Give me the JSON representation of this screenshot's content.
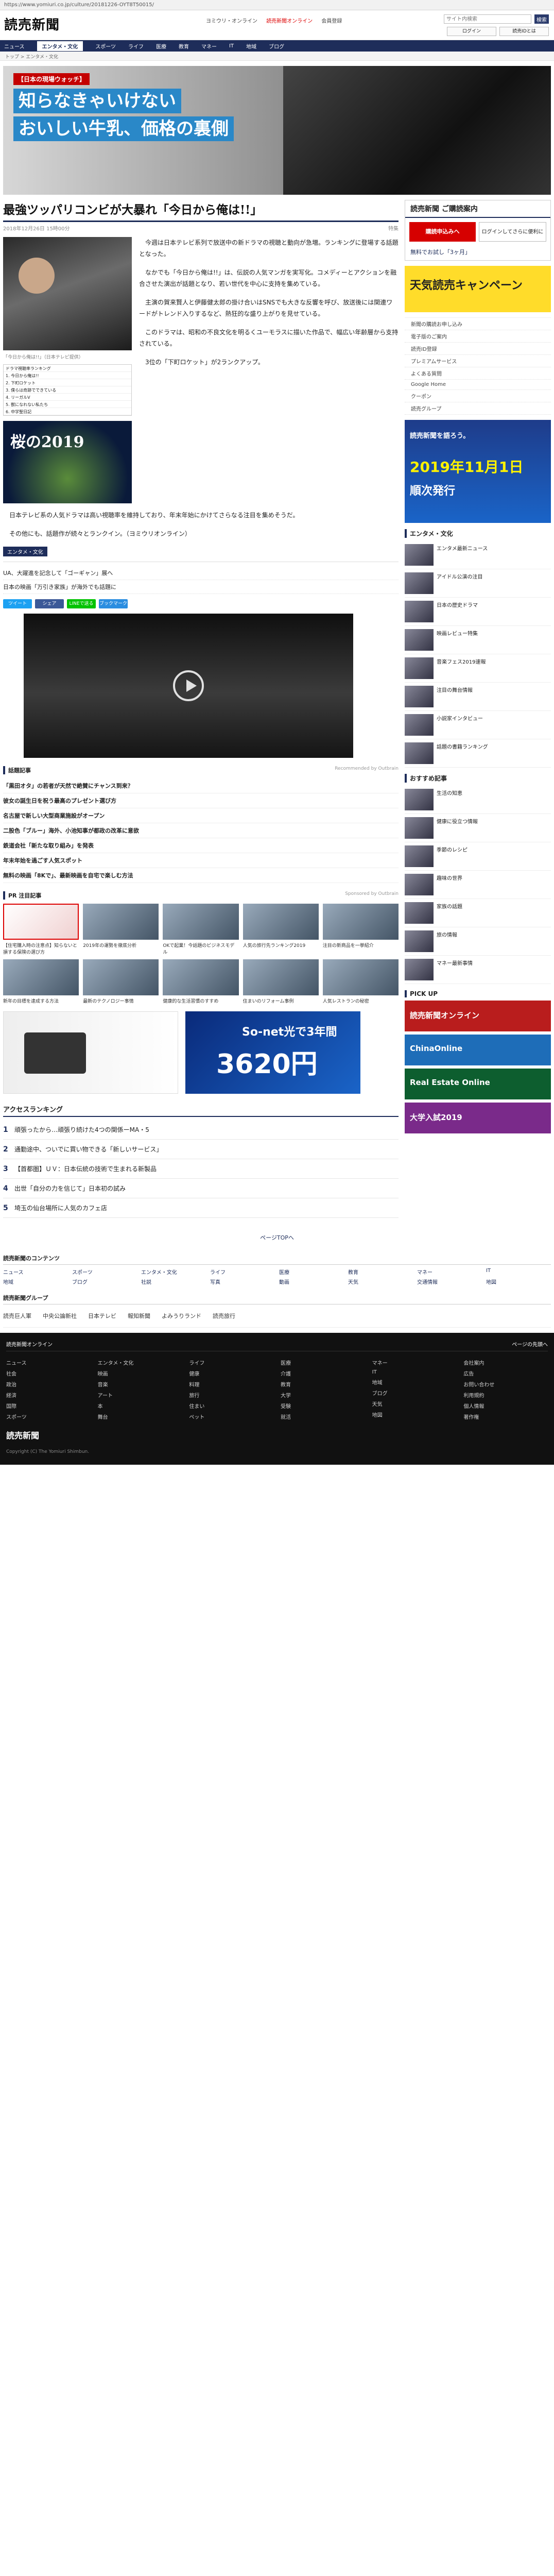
{
  "browser": {
    "url": "https://www.yomiuri.co.jp/culture/20181226-OYT8T50015/"
  },
  "site": {
    "logo_text": "読売新聞",
    "top_links": [
      "ヨミウリ・オンライン",
      "読売新聞オンライン",
      "会員登録"
    ],
    "search_placeholder": "サイト内検索",
    "search_button": "検索",
    "badges": [
      "ログイン",
      "読売IDとは"
    ]
  },
  "nav": {
    "items": [
      "ニュース",
      "エンタメ・文化",
      "スポーツ",
      "ライフ",
      "医療",
      "教育",
      "マネー",
      "IT",
      "地域",
      "ブログ"
    ],
    "active_index": 1,
    "breadcrumb": "トップ > エンタメ・文化"
  },
  "hero": {
    "tag": "【日本の現場ウォッチ】",
    "lines": [
      "【日本の現場ウォッチ】",
      "知らなきゃいけない",
      "おいしい牛乳、価格の裏側"
    ]
  },
  "article": {
    "title": "最強ツッパリコンビが大暴れ「今日から俺は!!」",
    "meta_left": "2018年12月26日 15時00分",
    "meta_right": "特集",
    "photo_caption": "「今日から俺は!!」（日本テレビ提供）",
    "table_rows": [
      "ドラマ視聴率ランキング",
      "1. 今日から俺は!!",
      "2. 下町ロケット",
      "3. 僕らは奇跡でできている",
      "4. リーガルV",
      "5. 獣になれない私たち",
      "6. 中学聖日記"
    ],
    "ad_card_text": "桜の2019",
    "paragraphs": [
      "今週は日本テレビ系列で放送中の新ドラマの視聴と動向が急増。ランキングに登場する話題となった。",
      "なかでも「今日から俺は!!」は、伝説の人気マンガを実写化。コメディーとアクションを融合させた演出が話題となり、若い世代を中心に支持を集めている。",
      "主演の賀来賢人と伊藤健太郎の掛け合いはSNSでも大きな反響を呼び、放送後には関連ワードがトレンド入りするなど、熱狂的な盛り上がりを見せている。",
      "このドラマは、昭和の不良文化を明るくユーモラスに描いた作品で、幅広い年齢層から支持されている。",
      "3位の「下町ロケット」が2ランクアップ。"
    ],
    "tail_paragraphs": [
      "日本テレビ系の人気ドラマは高い視聴率を維持しており、年末年始にかけてさらなる注目を集めそうだ。",
      "その他にも、話題作が続々とランクイン。（ヨミウリオンライン）"
    ],
    "category_tag": "エンタメ・文化",
    "related": [
      "UA、大躍進を記念して「ゴーギャン」展へ",
      "日本の映画「万引き家族」が海外でも話題に"
    ],
    "share_buttons": [
      "ツイート",
      "シェア",
      "LINEで送る",
      "ブックマーク"
    ],
    "share_colors": [
      "#1da1f2",
      "#3b5998",
      "#00c300",
      "#2a8de0"
    ]
  },
  "sections": {
    "news_label": "話題記事",
    "news_sub": "Recommended by Outbrain",
    "news_items": [
      "「黒田オタ」の若者が天然で絶賛にチャンス到来？",
      "彼女の誕生日を祝う最高のプレゼント選び方",
      "名古屋で新しい大型商業施設がオープン",
      "二股色「ブルー」海外、小池知事が都政の改革に意欲",
      "鉄道会社「新たな取り組み」を発表",
      "年末年始を過ごす人気スポット",
      "無料の映画「8Kで」、最新映画を自宅で楽しむ方法"
    ],
    "pr_label": "PR 注目記事",
    "pr_sub": "Sponsored by Outbrain",
    "cards": [
      "【住宅購入時の注意点】知らないと損する保険の選び方",
      "2019年の運勢を徹底分析",
      "OKで起業！今話題のビジネスモデル",
      "人気の旅行先ランキング2019",
      "注目の新商品を一挙紹介",
      "新年の目標を達成する方法",
      "最新のテクノロジー事情",
      "健康的な生活習慣のすすめ",
      "住まいのリフォーム事例",
      "人気レストランの秘密"
    ],
    "ad_sonet_small": "So-net光で3年間",
    "ad_sonet_big": "3620円",
    "ranking_title": "アクセスランキング",
    "ranking": [
      "頑張ったから…頑張り続けた4つの関係ーMA・5",
      "通勤途中、ついでに買い物できる「新しいサービス」",
      "【首都圏】ＵＶ：日本伝統の技術で生まれる新製品",
      "出世「自分の力を信じて」日本初の試み",
      "埼玉の仙台場所に人気のカフェ店"
    ],
    "pager": "ページTOPへ"
  },
  "sidebar": {
    "subscribe_title": "読売新聞 ご購読案内",
    "subscribe_btn": "購読申込みへ",
    "subscribe_line": "ログインしてさらに便利に",
    "subscribe_note": "無料でお試し「3ヶ月」",
    "yellow_ad": "天気読売キャンペーン",
    "side_list": [
      "新聞の購読お申し込み",
      "電子版のご案内",
      "読売ID登録",
      "プレミアムサービス",
      "よくある質問",
      "Google Home",
      "クーポン",
      "読売グループ"
    ],
    "blue_ad_headline": "読売新聞を語ろう。",
    "blue_ad_big": "2019年11月1日",
    "blue_ad_small": "順次発行",
    "entertainment_head": "エンタメ・文化",
    "side_items": [
      "エンタメ最新ニュース",
      "アイドル公演の注目",
      "日本の歴史ドラマ",
      "映画レビュー特集",
      "音楽フェス2019速報",
      "注目の舞台情報",
      "小説家インタビュー",
      "話題の書籍ランキング"
    ],
    "recommend_head": "おすすめ記事",
    "recommend_items": [
      "生活の知恵",
      "健康に役立つ情報",
      "季節のレシピ",
      "趣味の世界",
      "家族の話題",
      "旅の情報",
      "マネー最新事情"
    ],
    "pickup_head": "PICK UP",
    "banners": [
      "読売新聞オンライン",
      "ChinaOnline",
      "Real Estate Online",
      "大学入試2019"
    ],
    "banner_colors": [
      "#b91d1d",
      "#1e6db8",
      "#0d5e2f",
      "#7a2a8a"
    ]
  },
  "services": {
    "title": "読売新聞のコンテンツ",
    "links": [
      "ニュース",
      "スポーツ",
      "エンタメ・文化",
      "ライフ",
      "医療",
      "教育",
      "マネー",
      "IT",
      "地域",
      "ブログ",
      "社説",
      "写真",
      "動画",
      "天気",
      "交通情報",
      "地図"
    ],
    "title2": "読売新聞グループ",
    "group": [
      "読売巨人軍",
      "中央公論新社",
      "日本テレビ",
      "報知新聞",
      "よみうりランド",
      "読売旅行"
    ]
  },
  "footer": {
    "top_left": "読売新聞オンライン",
    "top_right": "ページの先頭へ",
    "columns": [
      [
        "ニュース",
        "社会",
        "政治",
        "経済",
        "国際",
        "スポーツ"
      ],
      [
        "エンタメ・文化",
        "映画",
        "音楽",
        "アート",
        "本",
        "舞台"
      ],
      [
        "ライフ",
        "健康",
        "料理",
        "旅行",
        "住まい",
        "ペット"
      ],
      [
        "医療",
        "介護",
        "教育",
        "大学",
        "受験",
        "就活"
      ],
      [
        "マネー",
        "IT",
        "地域",
        "ブログ",
        "天気",
        "地図"
      ],
      [
        "会社案内",
        "広告",
        "お問い合わせ",
        "利用規約",
        "個人情報",
        "著作権"
      ]
    ],
    "copyright": "Copyright (C) The Yomiuri Shimbun.",
    "logo": "読売新聞"
  }
}
